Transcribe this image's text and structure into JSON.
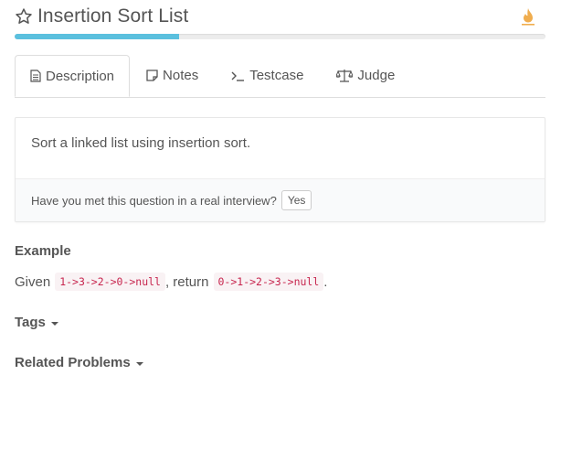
{
  "header": {
    "title": "Insertion Sort List",
    "star_icon": "star-outline-icon",
    "flame_icon": "flame-icon",
    "flame_color": "#f0ad4e"
  },
  "progress": {
    "percent": 31,
    "color": "#5bc0de"
  },
  "tabs": [
    {
      "label": "Description",
      "icon": "file-text-icon",
      "active": true
    },
    {
      "label": "Notes",
      "icon": "sticky-note-icon",
      "active": false
    },
    {
      "label": "Testcase",
      "icon": "terminal-icon",
      "active": false
    },
    {
      "label": "Judge",
      "icon": "balance-scale-icon",
      "active": false
    }
  ],
  "description": {
    "text": "Sort a linked list using insertion sort.",
    "interview_question": "Have you met this question in a real interview?",
    "yes_label": "Yes"
  },
  "example": {
    "heading": "Example",
    "given_label": "Given",
    "input_code": "1->3->2->0->null",
    "return_label": ", return",
    "output_code": "0->1->2->3->null",
    "end_punct": "."
  },
  "tags": {
    "heading": "Tags"
  },
  "related": {
    "heading": "Related Problems"
  }
}
